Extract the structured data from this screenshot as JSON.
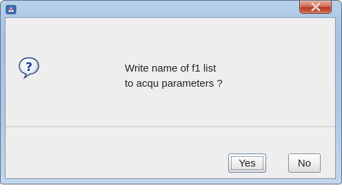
{
  "dialog": {
    "message_line1": "Write name of f1 list",
    "message_line2": "to acqu parameters ?",
    "icon": "question-icon",
    "title_icon": "app-icon"
  },
  "titlebar": {
    "close_icon": "close-icon"
  },
  "buttons": {
    "yes_label": "Yes",
    "no_label": "No"
  }
}
